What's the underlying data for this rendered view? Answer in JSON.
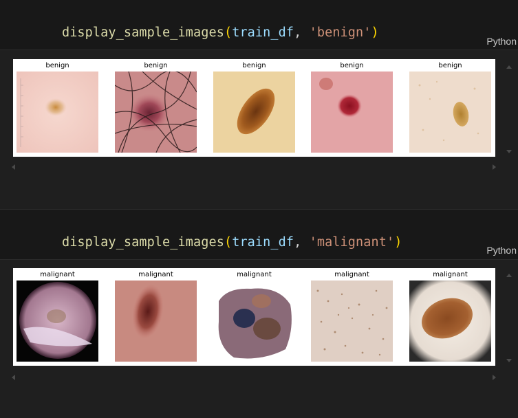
{
  "cells": [
    {
      "code": {
        "fn": "display_sample_images",
        "open": "(",
        "var": "train_df",
        "comma": ", ",
        "str": "'benign'",
        "close": ")"
      },
      "language": "Python",
      "output": {
        "images": [
          {
            "title": "benign",
            "icon": "skin-lesion-image"
          },
          {
            "title": "benign",
            "icon": "skin-lesion-image"
          },
          {
            "title": "benign",
            "icon": "skin-lesion-image"
          },
          {
            "title": "benign",
            "icon": "skin-lesion-image"
          },
          {
            "title": "benign",
            "icon": "skin-lesion-image"
          }
        ]
      }
    },
    {
      "code": {
        "fn": "display_sample_images",
        "open": "(",
        "var": "train_df",
        "comma": ", ",
        "str": "'malignant'",
        "close": ")"
      },
      "language": "Python",
      "output": {
        "images": [
          {
            "title": "malignant",
            "icon": "skin-lesion-image"
          },
          {
            "title": "malignant",
            "icon": "skin-lesion-image"
          },
          {
            "title": "malignant",
            "icon": "skin-lesion-image"
          },
          {
            "title": "malignant",
            "icon": "skin-lesion-image"
          },
          {
            "title": "malignant",
            "icon": "skin-lesion-image"
          }
        ]
      }
    }
  ],
  "colors": {
    "editor_bg": "#1f1f1f",
    "cell_bg": "#181818",
    "function": "#dcdcaa",
    "variable": "#9cdcfe",
    "string": "#ce9178",
    "bracket": "#ffd700"
  }
}
